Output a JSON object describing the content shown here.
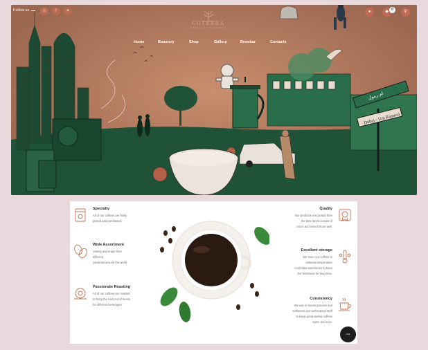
{
  "header": {
    "follow_label": "Follow us",
    "social": [
      {
        "icon": "instagram-icon",
        "glyph": "◎"
      },
      {
        "icon": "facebook-icon",
        "glyph": "f"
      },
      {
        "icon": "twitter-icon",
        "glyph": "✦"
      }
    ],
    "logo_word": "COTERRA",
    "logo_sub": "SPECIALTY ROASTERS",
    "cart_count": "0",
    "right_icons": [
      {
        "icon": "user-icon",
        "glyph": "●"
      },
      {
        "icon": "cart-icon",
        "glyph": "◆"
      },
      {
        "icon": "search-icon",
        "glyph": "⚲"
      }
    ]
  },
  "nav": [
    "Home",
    "Roastery",
    "Shop",
    "Gallery",
    "Brewbar",
    "Contacts"
  ],
  "hero": {
    "sign_text": "Dubai - Um Ramool",
    "arabic_sign": "ام رمول"
  },
  "features_left": [
    {
      "title": "Specialty",
      "desc": [
        "All of our coffees are finely",
        "picked and purchased."
      ],
      "icon": "coffee-bag-icon"
    },
    {
      "title": "Wide Assortment",
      "desc": [
        "Variety and origin from",
        "different",
        "countries around the world"
      ],
      "icon": "coffee-beans-icon"
    },
    {
      "title": "Passionate Roasting",
      "desc": [
        "All of our coffees are roasted",
        "to bring the best out of beans",
        "for different beverages"
      ],
      "icon": "roaster-icon"
    }
  ],
  "features_right": [
    {
      "title": "Quality",
      "desc": [
        "Our products are picked from",
        "the best farms consist of",
        "micro and nano lots as well."
      ],
      "icon": "quality-badge-icon"
    },
    {
      "title": "Excellent storage",
      "desc": [
        "We store our coffees in",
        "ambient temperature",
        "controlled warehouse to keep",
        "the freshness for long time."
      ],
      "icon": "thermometer-icon"
    },
    {
      "title": "Consistency",
      "desc": [
        "We use in-house process and",
        "softwares and well-trained staff",
        "to keep great tasting coffees",
        "same and ever."
      ],
      "icon": "coffee-cup-icon"
    }
  ],
  "chat_label": "chat",
  "colors": {
    "hero_bg": "#b07a5e",
    "forest_green": "#1f5237",
    "accent": "#c26a55",
    "icon_brown": "#c0714f",
    "page_bg": "#ead9dc"
  }
}
